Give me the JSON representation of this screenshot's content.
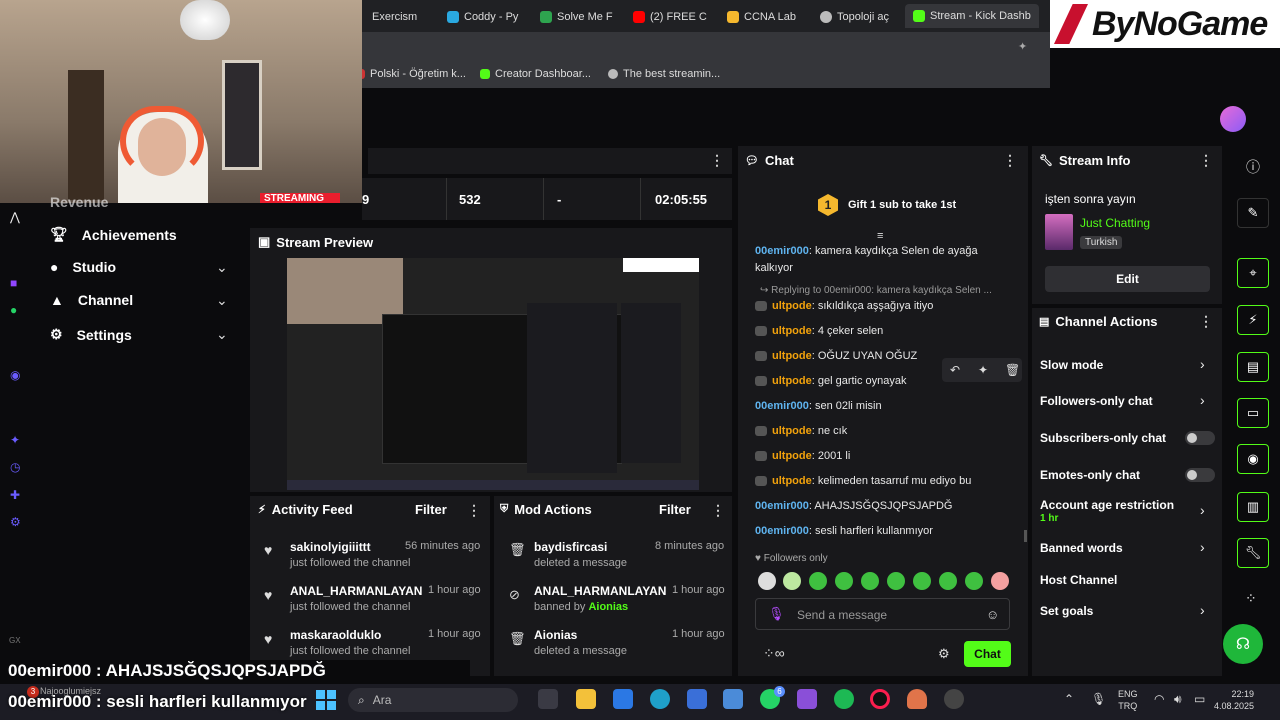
{
  "browser": {
    "tabs": [
      {
        "label": "Exercism",
        "color": "#6464d8"
      },
      {
        "label": "Coddy - Py",
        "color": "#2aa9e0"
      },
      {
        "label": "Solve Me F",
        "color": "#2ea44f"
      },
      {
        "label": "(2) FREE C",
        "color": "#ff0000"
      },
      {
        "label": "CCNA Lab",
        "color": "#f5b82e"
      },
      {
        "label": "Topoloji aç",
        "color": "#bbbbbb"
      },
      {
        "label": "Stream - Kick Dashb",
        "color": "#53fc18"
      }
    ],
    "bookmarks": [
      "Polski - Öğretim k...",
      "Creator Dashboar...",
      "The best streamin..."
    ]
  },
  "watermark": {
    "brand": "ByNoGame"
  },
  "stats": {
    "col1": "9",
    "col2": "532",
    "col3": "-",
    "col4": "02:05:55",
    "overlay": "STREAMING"
  },
  "sidebar": {
    "hidden_item": "Revenue",
    "items": [
      {
        "label": "Achievements",
        "icon": "trophy-icon",
        "has_chevron": false
      },
      {
        "label": "Studio",
        "icon": "studio-icon",
        "has_chevron": true
      },
      {
        "label": "Channel",
        "icon": "person-icon",
        "has_chevron": true
      },
      {
        "label": "Settings",
        "icon": "gear-icon",
        "has_chevron": true
      }
    ],
    "footer": "GX"
  },
  "preview": {
    "title": "Stream Preview"
  },
  "activity": {
    "title": "Activity Feed",
    "filter": "Filter",
    "items": [
      {
        "name": "sakinolyigiiittt",
        "desc": "just followed the channel",
        "time": "56 minutes ago"
      },
      {
        "name": "ANAL_HARMANLAYAN",
        "desc": "just followed the channel",
        "time": "1 hour ago"
      },
      {
        "name": "maskaraolduklo",
        "desc": "just followed the channel",
        "time": "1 hour ago"
      }
    ]
  },
  "mod": {
    "title": "Mod Actions",
    "filter": "Filter",
    "items": [
      {
        "name": "baydisfircasi",
        "desc": "deleted a message",
        "by": "",
        "time": "8 minutes ago"
      },
      {
        "name": "ANAL_HARMANLAYAN",
        "desc": "banned by ",
        "by": "Aionias",
        "time": "1 hour ago"
      },
      {
        "name": "Aionias",
        "desc": "deleted a message",
        "by": "",
        "time": "1 hour ago"
      }
    ]
  },
  "chat": {
    "title": "Chat",
    "gift": "Gift 1 sub to take 1st",
    "gift_badge": "1",
    "reply_note": "Replying to 00emir000: kamera kaydıkça Selen ...",
    "messages": [
      {
        "user": "00emir000",
        "text": "kamera kaydıkça Selen de ayağa"
      },
      {
        "user": "",
        "text": "kalkıyor"
      },
      {
        "user": "ultpode",
        "text": "sıkıldıkça aşşağıya itiyo"
      },
      {
        "user": "ultpode",
        "text": "4 çeker selen"
      },
      {
        "user": "ultpode",
        "text": "OĞUZ UYAN OĞUZ"
      },
      {
        "user": "ultpode",
        "text": "gel gartic oynayak"
      },
      {
        "user": "00emir000",
        "text": "sen 02li misin"
      },
      {
        "user": "ultpode",
        "text": "ne cık"
      },
      {
        "user": "ultpode",
        "text": "2001 li"
      },
      {
        "user": "ultpode",
        "text": "kelimeden tasarruf mu ediyo bu"
      },
      {
        "user": "00emir000",
        "text": "AHAJSJSĞQSJQPSJAPDĞ"
      },
      {
        "user": "00emir000",
        "text": "sesli harfleri kullanmıyor"
      }
    ],
    "followers_only": "Followers only",
    "input_placeholder": "Send a message",
    "send_label": "Chat"
  },
  "stream_info": {
    "title": "Stream Info",
    "stream_title": "işten sonra yayın",
    "category": "Just Chatting",
    "language": "Turkish",
    "edit_label": "Edit"
  },
  "channel_actions": {
    "title": "Channel Actions",
    "items": [
      {
        "label": "Slow mode",
        "sub": "",
        "control": "chevron"
      },
      {
        "label": "Followers-only chat",
        "sub": "",
        "control": "chevron"
      },
      {
        "label": "Subscribers-only chat",
        "sub": "",
        "control": "toggle"
      },
      {
        "label": "Emotes-only chat",
        "sub": "",
        "control": "toggle"
      },
      {
        "label": "Account age restriction",
        "sub": "1 hr",
        "control": "chevron"
      },
      {
        "label": "Banned words",
        "sub": "",
        "control": "chevron"
      },
      {
        "label": "Host Channel",
        "sub": "",
        "control": "none"
      },
      {
        "label": "Set goals",
        "sub": "",
        "control": "chevron"
      }
    ]
  },
  "overlay_captions": {
    "line1": "00emir000 : AHAJSJSĞQSJQPSJAPDĞ",
    "line2": "00emir000 : sesli harfleri kullanmıyor"
  },
  "taskbar": {
    "search": "Ara",
    "notification_badge": "3",
    "notif_text": "Najooglumiejsz",
    "lang1": "ENG",
    "lang2": "TRQ",
    "time": "22:19",
    "date": "4.08.2025",
    "whatsapp_badge": "6"
  },
  "colors": {
    "accent": "#53fc18",
    "user_orange": "#f2a20c",
    "user_blue": "#5fb4f0",
    "panel": "#18181b"
  }
}
